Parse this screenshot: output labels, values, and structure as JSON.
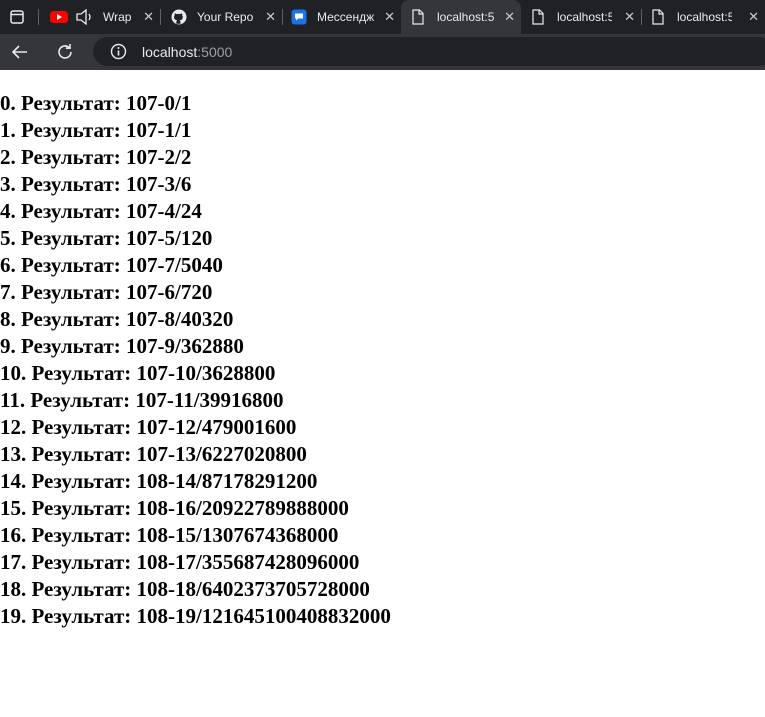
{
  "tabs": [
    {
      "title": "Wrap",
      "icon": "youtube-icon"
    },
    {
      "title": "Your Repo",
      "icon": "github-icon"
    },
    {
      "title": "Мессендж",
      "icon": "messenger-icon"
    },
    {
      "title": "localhost:5",
      "icon": "page-icon"
    },
    {
      "title": "localhost:5",
      "icon": "page-icon"
    },
    {
      "title": "localhost:5",
      "icon": "page-icon"
    }
  ],
  "address": {
    "host": "localhost",
    "port": ":5000"
  },
  "results": [
    "0. Результат: 107-0/1",
    "1. Результат: 107-1/1",
    "2. Результат: 107-2/2",
    "3. Результат: 107-3/6",
    "4. Результат: 107-4/24",
    "5. Результат: 107-5/120",
    "6. Результат: 107-7/5040",
    "7. Результат: 107-6/720",
    "8. Результат: 107-8/40320",
    "9. Результат: 107-9/362880",
    "10. Результат: 107-10/3628800",
    "11. Результат: 107-11/39916800",
    "12. Результат: 107-12/479001600",
    "13. Результат: 107-13/6227020800",
    "14. Результат: 108-14/87178291200",
    "15. Результат: 108-16/20922789888000",
    "16. Результат: 108-15/1307674368000",
    "17. Результат: 108-17/355687428096000",
    "18. Результат: 108-18/6402373705728000",
    "19. Результат: 108-19/121645100408832000"
  ]
}
